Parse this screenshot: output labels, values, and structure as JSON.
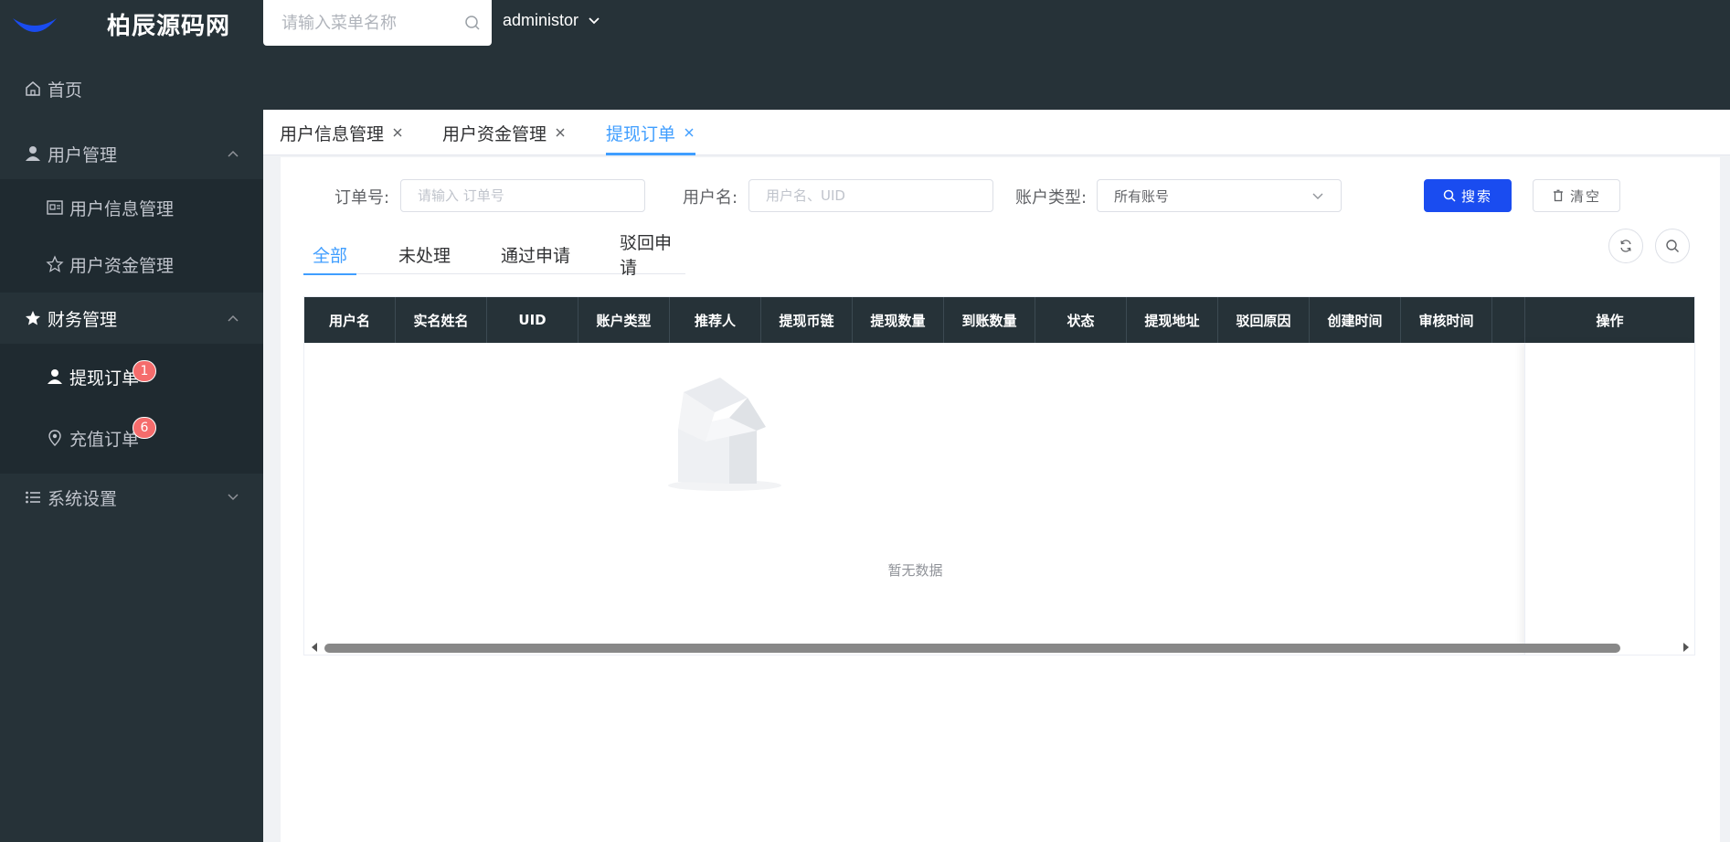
{
  "header": {
    "brand": "柏辰源码网",
    "search_placeholder": "请输入菜单名称",
    "user": "administor"
  },
  "sidebar": {
    "home": "首页",
    "user_mgmt": "用户管理",
    "user_info": "用户信息管理",
    "user_funds": "用户资金管理",
    "finance_mgmt": "财务管理",
    "withdraw_orders": "提现订单",
    "withdraw_badge": "1",
    "recharge_orders": "充值订单",
    "recharge_badge": "6",
    "system_settings": "系统设置"
  },
  "tabs": [
    {
      "label": "用户信息管理"
    },
    {
      "label": "用户资金管理"
    },
    {
      "label": "提现订单"
    }
  ],
  "filters": {
    "order_label": "订单号:",
    "order_placeholder": "请输入 订单号",
    "username_label": "用户名:",
    "username_placeholder": "用户名、UID",
    "account_type_label": "账户类型:",
    "account_type_value": "所有账号",
    "search_button": "搜索",
    "clear_button": "清空"
  },
  "subtabs": [
    "全部",
    "未处理",
    "通过申请",
    "驳回申请"
  ],
  "table": {
    "columns": [
      "用户名",
      "实名姓名",
      "UID",
      "账户类型",
      "推荐人",
      "提现币链",
      "提现数量",
      "到账数量",
      "状态",
      "提现地址",
      "驳回原因",
      "创建时间",
      "审核时间"
    ],
    "op_column": "操作",
    "empty_text": "暂无数据"
  },
  "colors": {
    "dark": "#263238",
    "accent": "#409eff",
    "primary_button": "#1a4cf0",
    "badge": "#f56c6c"
  }
}
